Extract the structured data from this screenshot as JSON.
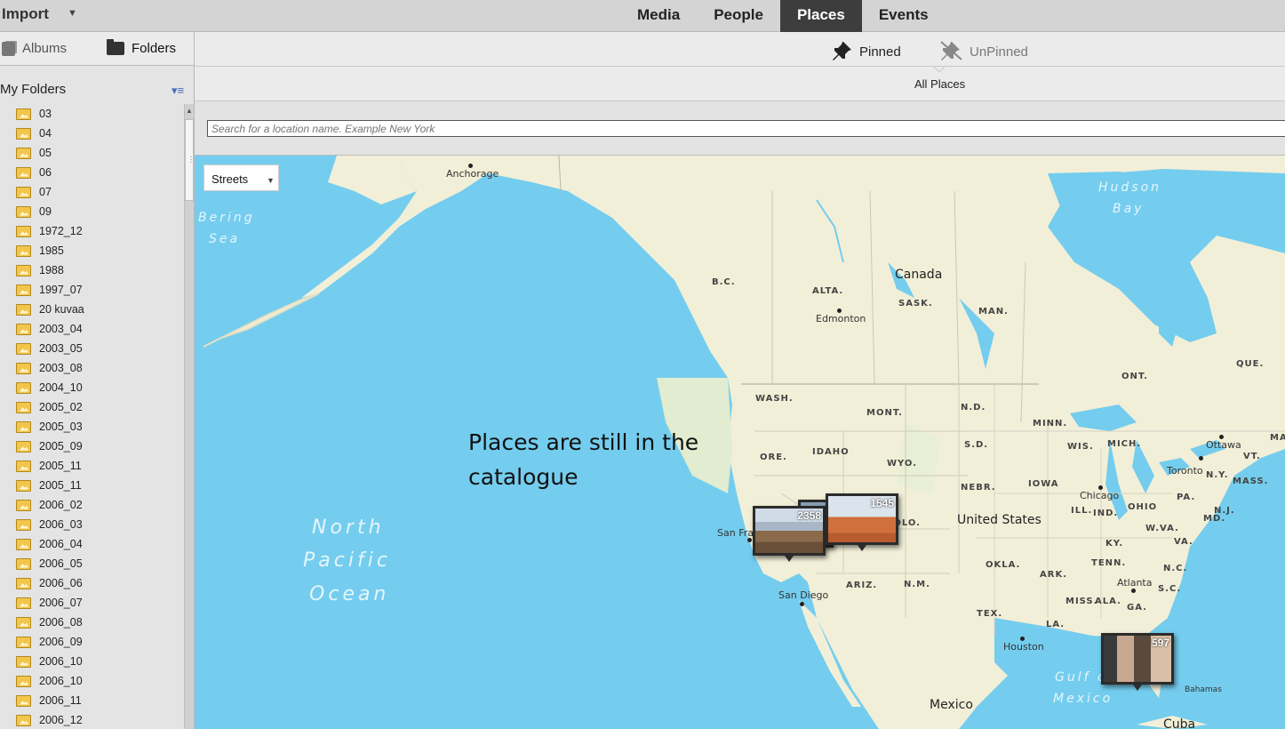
{
  "topbar": {
    "import_label": "Import",
    "tabs": [
      {
        "label": "Media"
      },
      {
        "label": "People"
      },
      {
        "label": "Places"
      },
      {
        "label": "Events"
      }
    ],
    "active_tab": "Places"
  },
  "left_panel": {
    "albums_label": "Albums",
    "folders_label": "Folders",
    "section_title": "My Folders",
    "folders": [
      "03",
      "04",
      "05",
      "06",
      "07",
      "09",
      "1972_12",
      "1985",
      "1988",
      "1997_07",
      "20 kuvaa",
      "2003_04",
      "2003_05",
      "2003_08",
      "2004_10",
      "2005_02",
      "2005_03",
      "2005_09",
      "2005_11",
      "2005_11",
      "2006_02",
      "2006_03",
      "2006_04",
      "2006_05",
      "2006_06",
      "2006_07",
      "2006_08",
      "2006_09",
      "2006_10",
      "2006_10",
      "2006_11",
      "2006_12"
    ]
  },
  "places": {
    "pinned_label": "Pinned",
    "unpinned_label": "UnPinned",
    "all_places_label": "All Places",
    "search_placeholder": "Search for a location name. Example New York"
  },
  "map": {
    "style_select_value": "Streets",
    "annotation_line1": "Places are still in the",
    "annotation_line2": "catalogue",
    "labels": {
      "anchorage": "Anchorage",
      "bering_sea_1": "Bering",
      "bering_sea_2": "Sea",
      "hudson_bay_1": "Hudson",
      "hudson_bay_2": "Bay",
      "canada": "Canada",
      "bc": "B.C.",
      "alta": "ALTA.",
      "sask": "SASK.",
      "man": "MAN.",
      "edmonton": "Edmonton",
      "ont": "ONT.",
      "que": "QUE.",
      "wash": "WASH.",
      "mont": "MONT.",
      "nd": "N.D.",
      "minn": "MINN.",
      "sd": "S.D.",
      "ore": "ORE.",
      "idaho": "IDAHO",
      "wyo": "WYO.",
      "wis": "WIS.",
      "mich": "MICH.",
      "ottawa": "Ottawa",
      "vt": "VT.",
      "ma": "MA",
      "toronto": "Toronto",
      "ny": "N.Y.",
      "mass": "MASS.",
      "nebr": "NEBR.",
      "iowa": "IOWA",
      "chicago": "Chicago",
      "pa": "PA.",
      "nj": "N.J.",
      "ill": "ILL.",
      "ind": "IND.",
      "ohio": "OHIO",
      "md": "MD.",
      "colo": "COLO.",
      "united_states": "United States",
      "wva": "W.VA.",
      "va": "VA.",
      "san_fran": "San Fra",
      "ky": "KY.",
      "north_pacific_1": "North",
      "north_pacific_2": "Pacific",
      "north_pacific_3": "Ocean",
      "okla": "OKLA.",
      "ark": "ARK.",
      "tenn": "TENN.",
      "nc": "N.C.",
      "atlanta": "Atlanta",
      "sc": "S.C.",
      "san_diego": "San Diego",
      "ariz": "ARIZ.",
      "nm": "N.M.",
      "miss": "MISS.",
      "ala": "ALA.",
      "ga": "GA.",
      "tex": "TEX.",
      "la": "LA.",
      "houston": "Houston",
      "gulf_1": "Gulf of",
      "gulf_2": "Mexico",
      "bahamas": "Bahamas",
      "mexico": "Mexico",
      "cuba": "Cuba"
    },
    "pins": [
      {
        "count": "2358"
      },
      {
        "count": "1545"
      },
      {
        "count": "597"
      }
    ]
  }
}
